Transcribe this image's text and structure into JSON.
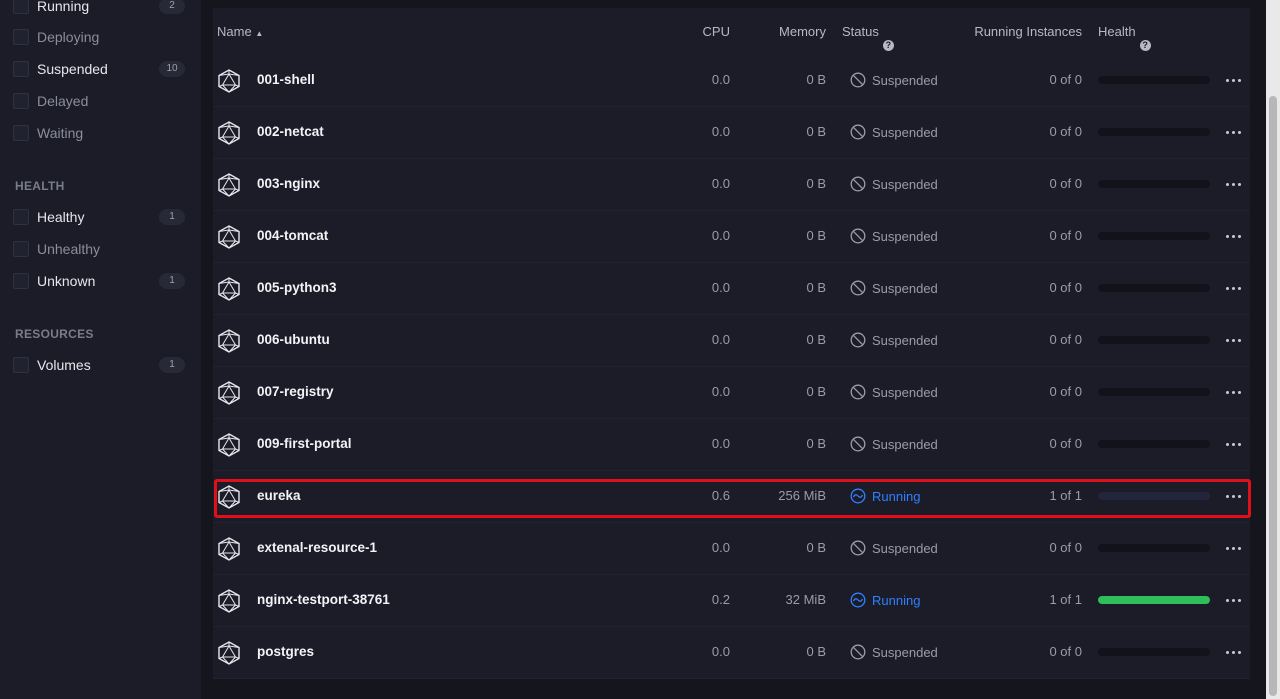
{
  "sidebar": {
    "status_filters": [
      {
        "label": "Running",
        "count": "2",
        "dim": false
      },
      {
        "label": "Deploying",
        "count": "",
        "dim": true
      },
      {
        "label": "Suspended",
        "count": "10",
        "dim": false
      },
      {
        "label": "Delayed",
        "count": "",
        "dim": true
      },
      {
        "label": "Waiting",
        "count": "",
        "dim": true
      }
    ],
    "health_heading": "HEALTH",
    "health_filters": [
      {
        "label": "Healthy",
        "count": "1",
        "dim": false
      },
      {
        "label": "Unhealthy",
        "count": "",
        "dim": true
      },
      {
        "label": "Unknown",
        "count": "1",
        "dim": false
      }
    ],
    "resources_heading": "RESOURCES",
    "resource_filters": [
      {
        "label": "Volumes",
        "count": "1",
        "dim": false
      }
    ]
  },
  "table": {
    "columns": {
      "name": "Name",
      "cpu": "CPU",
      "memory": "Memory",
      "status": "Status",
      "instances": "Running Instances",
      "health": "Health"
    },
    "sort_indicator": "▲",
    "rows": [
      {
        "name": "001-shell",
        "cpu": "0.0",
        "memory": "0 B",
        "status": "Suspended",
        "instances": "0 of 0",
        "health": 0,
        "running": false
      },
      {
        "name": "002-netcat",
        "cpu": "0.0",
        "memory": "0 B",
        "status": "Suspended",
        "instances": "0 of 0",
        "health": 0,
        "running": false
      },
      {
        "name": "003-nginx",
        "cpu": "0.0",
        "memory": "0 B",
        "status": "Suspended",
        "instances": "0 of 0",
        "health": 0,
        "running": false
      },
      {
        "name": "004-tomcat",
        "cpu": "0.0",
        "memory": "0 B",
        "status": "Suspended",
        "instances": "0 of 0",
        "health": 0,
        "running": false
      },
      {
        "name": "005-python3",
        "cpu": "0.0",
        "memory": "0 B",
        "status": "Suspended",
        "instances": "0 of 0",
        "health": 0,
        "running": false
      },
      {
        "name": "006-ubuntu",
        "cpu": "0.0",
        "memory": "0 B",
        "status": "Suspended",
        "instances": "0 of 0",
        "health": 0,
        "running": false
      },
      {
        "name": "007-registry",
        "cpu": "0.0",
        "memory": "0 B",
        "status": "Suspended",
        "instances": "0 of 0",
        "health": 0,
        "running": false
      },
      {
        "name": "009-first-portal",
        "cpu": "0.0",
        "memory": "0 B",
        "status": "Suspended",
        "instances": "0 of 0",
        "health": 0,
        "running": false
      },
      {
        "name": "eureka",
        "cpu": "0.6",
        "memory": "256 MiB",
        "status": "Running",
        "instances": "1 of 1",
        "health": 0,
        "running": true,
        "pending": true
      },
      {
        "name": "extenal-resource-1",
        "cpu": "0.0",
        "memory": "0 B",
        "status": "Suspended",
        "instances": "0 of 0",
        "health": 0,
        "running": false
      },
      {
        "name": "nginx-testport-38761",
        "cpu": "0.2",
        "memory": "32 MiB",
        "status": "Running",
        "instances": "1 of 1",
        "health": 1,
        "running": true
      },
      {
        "name": "postgres",
        "cpu": "0.0",
        "memory": "0 B",
        "status": "Suspended",
        "instances": "0 of 0",
        "health": 0,
        "running": false
      }
    ]
  },
  "colors": {
    "running": "#2f80ff",
    "healthy": "#2fbf5a",
    "highlight": "#e0101a"
  }
}
